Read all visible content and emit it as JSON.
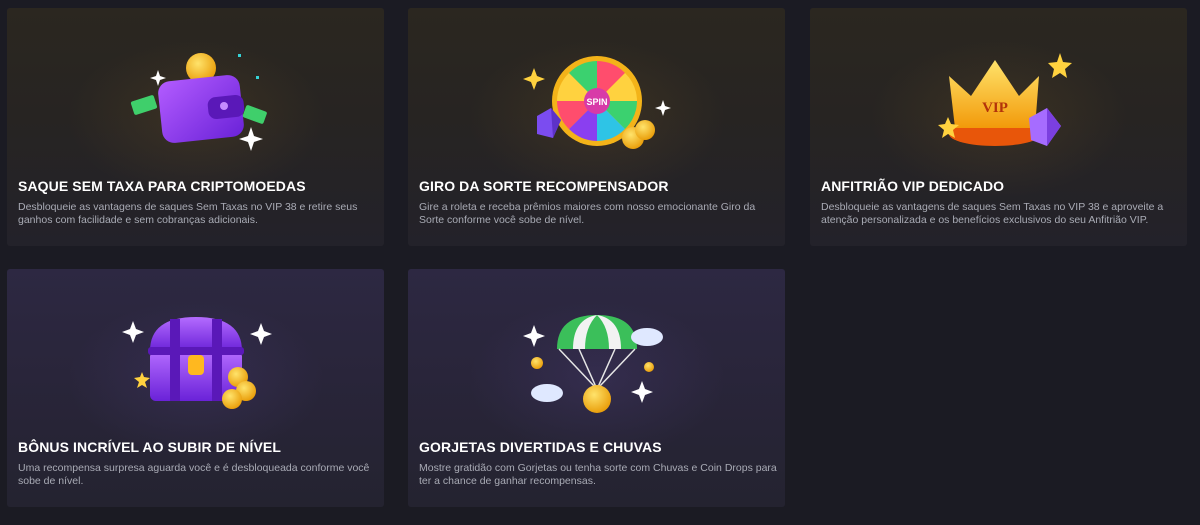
{
  "cards": [
    {
      "title": "SAQUE SEM TAXA PARA CRIPTOMOEDAS",
      "description": "Desbloqueie as vantagens de saques Sem Taxas no VIP 38 e retire seus ganhos com facilidade e sem cobranças adicionais.",
      "icon": "wallet-coins-icon"
    },
    {
      "title": "GIRO DA SORTE RECOMPENSADOR",
      "description": "Gire a roleta e receba prêmios maiores com nosso emocionante Giro da Sorte conforme você sobe de nível.",
      "icon": "spin-wheel-icon",
      "wheel_label": "SPIN"
    },
    {
      "title": "ANFITRIÃO VIP DEDICADO",
      "description": "Desbloqueie as vantagens de saques Sem Taxas no VIP 38 e aproveite a atenção personalizada e os benefícios exclusivos do seu Anfitrião VIP.",
      "icon": "vip-crown-icon",
      "crown_label": "VIP"
    },
    {
      "title": "BÔNUS INCRÍVEL AO SUBIR DE NÍVEL",
      "description": "Uma recompensa surpresa aguarda você e é desbloqueada conforme você sobe de nível.",
      "icon": "treasure-chest-icon"
    },
    {
      "title": "GORJETAS DIVERTIDAS E CHUVAS",
      "description": "Mostre gratidão com Gorjetas ou tenha sorte com Chuvas e Coin Drops para ter a chance de ganhar recompensas.",
      "icon": "parachute-coin-icon"
    }
  ],
  "colors": {
    "page_bg": "#1b1b23",
    "title": "#ffffff",
    "description": "#a9abb5",
    "gold": "#f5b80e",
    "purple": "#8a3ff0"
  }
}
